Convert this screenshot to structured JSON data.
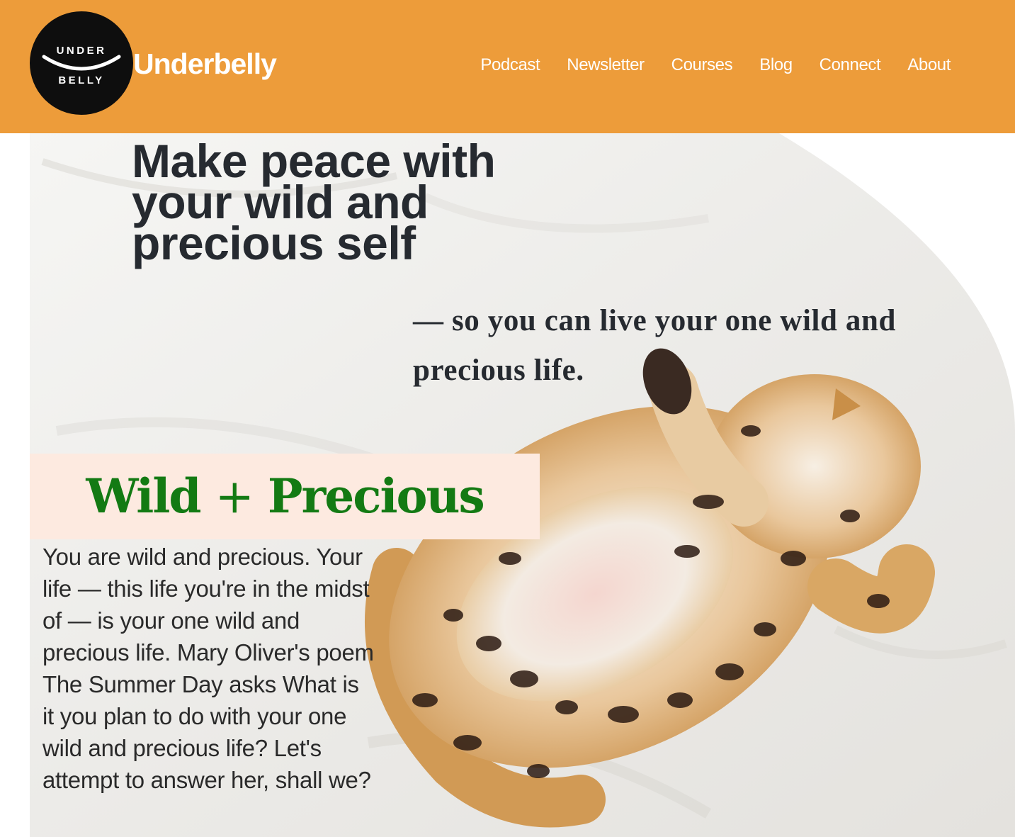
{
  "colors": {
    "header_bg": "#ed9c3a",
    "headline": "#262a30",
    "section_title": "#137a13",
    "section_banner_bg": "#fdeae0",
    "logo_bg": "#0e0e0e"
  },
  "header": {
    "logo": {
      "line1": "UNDER",
      "line2": "BELLY"
    },
    "brand": "Underbelly",
    "nav": {
      "items": [
        {
          "label": "Podcast"
        },
        {
          "label": "Newsletter"
        },
        {
          "label": "Courses"
        },
        {
          "label": "Blog"
        },
        {
          "label": "Connect"
        },
        {
          "label": "About"
        }
      ]
    }
  },
  "hero": {
    "headline": "Make peace with your wild and precious self",
    "tagline": "— so you can live your one wild and precious life.",
    "image": "bengal-cat-lying-on-back-on-white-bedsheet"
  },
  "section": {
    "title_part1": "Wild",
    "title_plus": "+",
    "title_part2": "Precious",
    "intro": "You are wild and precious. Your life — this life you're in the midst of — is your one wild and precious life. Mary Oliver's poem The Summer Day asks What is it you plan to do with your one wild and precious life? Let's attempt to answer her, shall we?"
  }
}
